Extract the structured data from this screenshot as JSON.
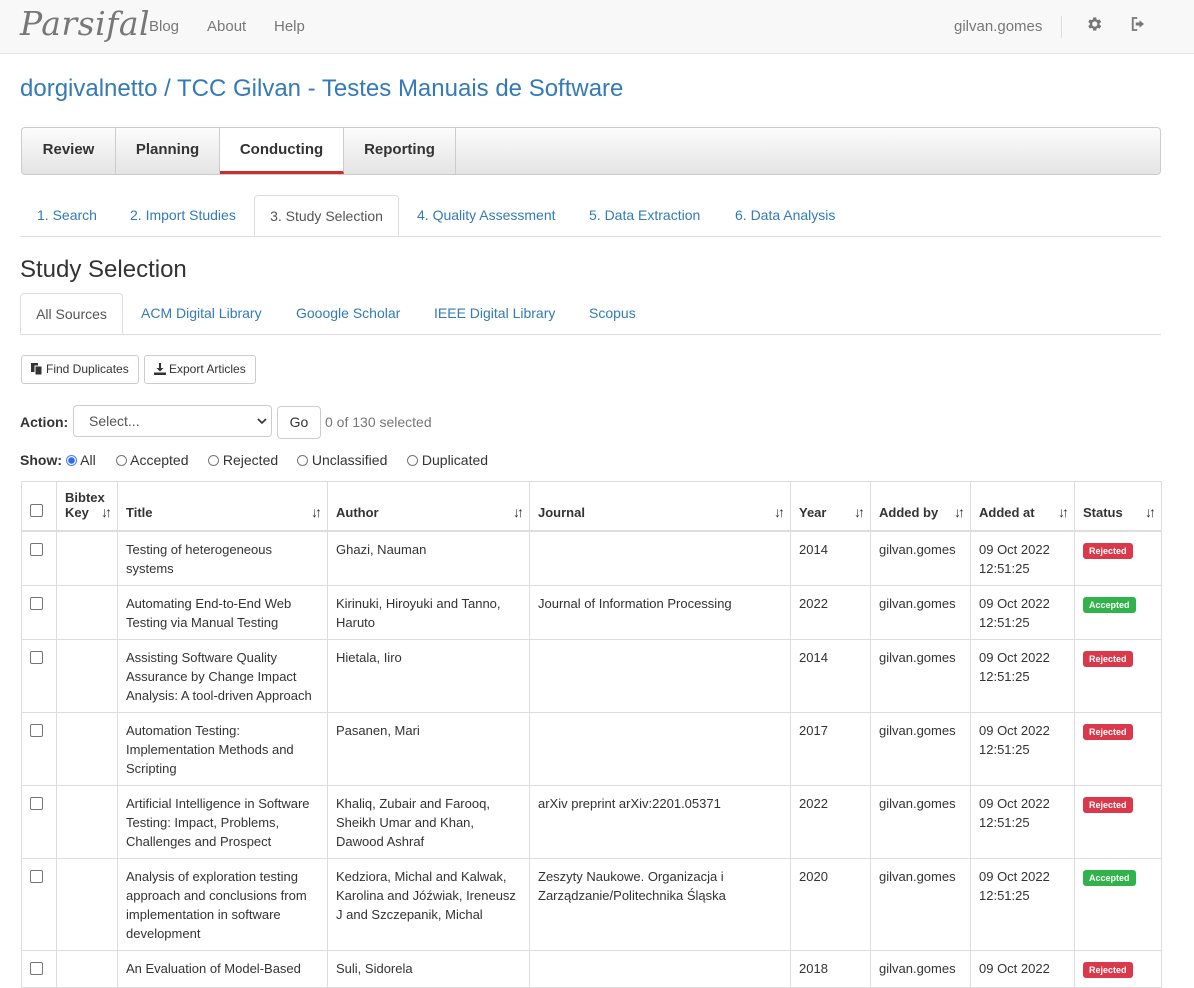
{
  "nav": {
    "brand": "Parsifal",
    "links": [
      "Blog",
      "About",
      "Help"
    ],
    "user": "gilvan.gomes"
  },
  "page_title": "dorgivalnetto / TCC Gilvan - Testes Manuais de Software",
  "main_tabs": [
    "Review",
    "Planning",
    "Conducting",
    "Reporting"
  ],
  "sub_tabs": [
    "1. Search",
    "2. Import Studies",
    "3. Study Selection",
    "4. Quality Assessment",
    "5. Data Extraction",
    "6. Data Analysis"
  ],
  "section_title": "Study Selection",
  "source_tabs": [
    "All Sources",
    "ACM Digital Library",
    "Gooogle Scholar",
    "IEEE Digital Library",
    "Scopus"
  ],
  "buttons": {
    "find_duplicates": "Find Duplicates",
    "export_articles": "Export Articles",
    "go": "Go"
  },
  "action": {
    "label": "Action:",
    "select_value": "Select...",
    "selected_count": "0 of 130 selected"
  },
  "show": {
    "label": "Show:",
    "options": [
      "All",
      "Accepted",
      "Rejected",
      "Unclassified",
      "Duplicated"
    ],
    "selected": "All"
  },
  "table": {
    "headers": [
      "Bibtex Key",
      "Title",
      "Author",
      "Journal",
      "Year",
      "Added by",
      "Added at",
      "Status"
    ],
    "rows": [
      {
        "title": "Testing of heterogeneous systems",
        "author": "Ghazi, Nauman",
        "journal": "",
        "year": "2014",
        "added_by": "gilvan.gomes",
        "added_at": "09 Oct 2022 12:51:25",
        "status": "Rejected"
      },
      {
        "title": "Automating End-to-End Web Testing via Manual Testing",
        "author": "Kirinuki, Hiroyuki and Tanno, Haruto",
        "journal": "Journal of Information Processing",
        "year": "2022",
        "added_by": "gilvan.gomes",
        "added_at": "09 Oct 2022 12:51:25",
        "status": "Accepted"
      },
      {
        "title": "Assisting Software Quality Assurance by Change Impact Analysis: A tool-driven Approach",
        "author": "Hietala, Iiro",
        "journal": "",
        "year": "2014",
        "added_by": "gilvan.gomes",
        "added_at": "09 Oct 2022 12:51:25",
        "status": "Rejected"
      },
      {
        "title": "Automation Testing: Implementation Methods and Scripting",
        "author": "Pasanen, Mari",
        "journal": "",
        "year": "2017",
        "added_by": "gilvan.gomes",
        "added_at": "09 Oct 2022 12:51:25",
        "status": "Rejected"
      },
      {
        "title": "Artificial Intelligence in Software Testing: Impact, Problems, Challenges and Prospect",
        "author": "Khaliq, Zubair and Farooq, Sheikh Umar and Khan, Dawood Ashraf",
        "journal": "arXiv preprint arXiv:2201.05371",
        "year": "2022",
        "added_by": "gilvan.gomes",
        "added_at": "09 Oct 2022 12:51:25",
        "status": "Rejected"
      },
      {
        "title": "Analysis of exploration testing approach and conclusions from implementation in software development",
        "author": "Kedziora, Michal and Kalwak, Karolina and Jóźwiak, Ireneusz J and Szczepanik, Michal",
        "journal": "Zeszyty Naukowe. Organizacja i Zarządzanie/Politechnika Śląska",
        "year": "2020",
        "added_by": "gilvan.gomes",
        "added_at": "09 Oct 2022 12:51:25",
        "status": "Accepted"
      },
      {
        "title": "An Evaluation of Model-Based",
        "author": "Suli, Sidorela",
        "journal": "",
        "year": "2018",
        "added_by": "gilvan.gomes",
        "added_at": "09 Oct 2022",
        "status": "Rejected"
      }
    ]
  }
}
